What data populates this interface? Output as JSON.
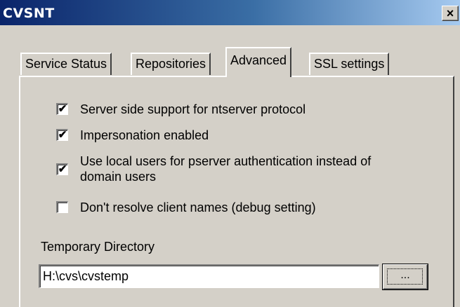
{
  "window": {
    "title": "CVSNT",
    "close_label": "×"
  },
  "tabs": [
    {
      "label": "Service Status",
      "active": false
    },
    {
      "label": "Repositories",
      "active": false
    },
    {
      "label": "Advanced",
      "active": true
    },
    {
      "label": "SSL settings",
      "active": false
    }
  ],
  "options": [
    {
      "label": "Server side support for ntserver protocol",
      "checked": true,
      "mark": "✔"
    },
    {
      "label": "Impersonation enabled",
      "checked": true,
      "mark": "✔"
    },
    {
      "label_line1": "Use local users for pserver authentication instead of",
      "label_line2": "domain users",
      "checked": true,
      "mark": "✔"
    },
    {
      "label": "Don't resolve client names (debug setting)",
      "checked": false,
      "mark": ""
    }
  ],
  "temp_dir": {
    "label": "Temporary Directory",
    "value": "H:\\cvs\\cvstemp",
    "browse_label": "..."
  }
}
